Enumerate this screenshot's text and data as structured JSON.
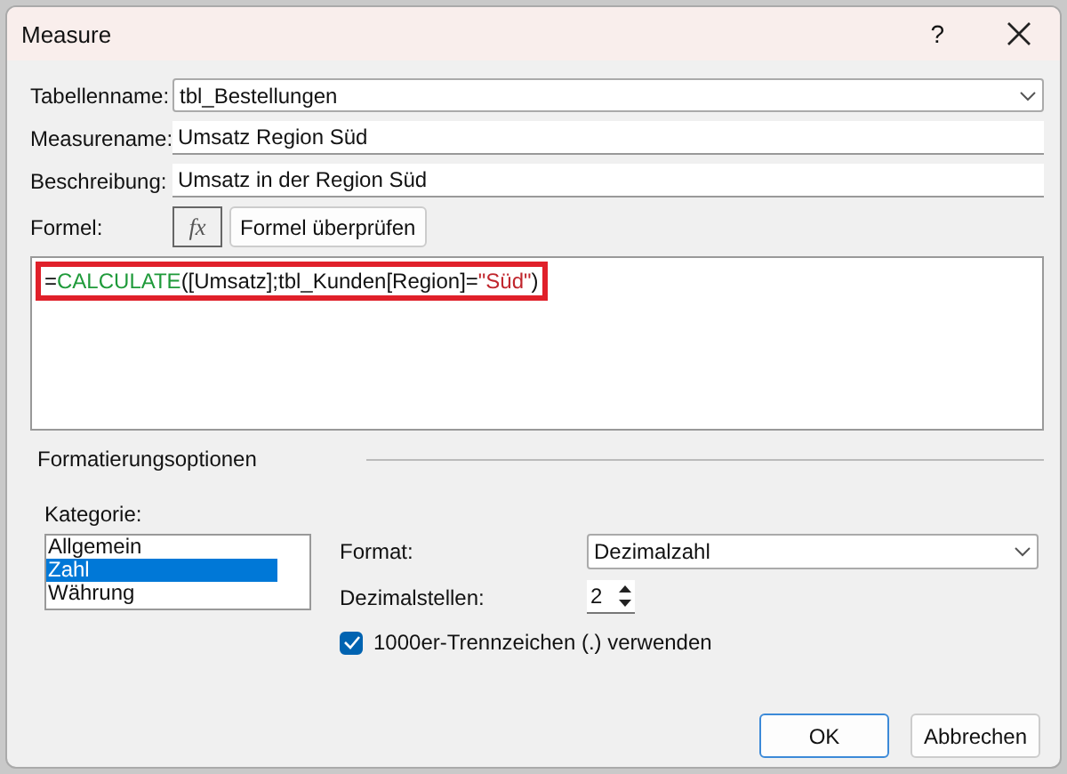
{
  "window": {
    "title": "Measure",
    "help": "?"
  },
  "table_name": {
    "label": "Tabellenname:",
    "value": "tbl_Bestellungen"
  },
  "measure_name": {
    "label": "Measurename:",
    "value": "Umsatz Region Süd"
  },
  "description": {
    "label": "Beschreibung:",
    "value": "Umsatz in der Region Süd"
  },
  "formula": {
    "label": "Formel:",
    "fx": "fx",
    "check_button": "Formel überprüfen",
    "highlighted": true,
    "segments": [
      {
        "kind": "plain",
        "text": "="
      },
      {
        "kind": "function",
        "text": "CALCULATE"
      },
      {
        "kind": "plain",
        "text": "([Umsatz];tbl_Kunden[Region]="
      },
      {
        "kind": "string",
        "text": "\"Süd\""
      },
      {
        "kind": "plain",
        "text": ")"
      }
    ]
  },
  "format_options": {
    "title": "Formatierungsoptionen",
    "category_label": "Kategorie:",
    "categories": [
      {
        "label": "Allgemein",
        "selected": false
      },
      {
        "label": "Zahl",
        "selected": true
      },
      {
        "label": "Währung",
        "selected": false
      }
    ],
    "format_label": "Format:",
    "format_value": "Dezimalzahl",
    "decimals_label": "Dezimalstellen:",
    "decimals_value": "2",
    "separator": {
      "label": "1000er-Trennzeichen (.) verwenden",
      "checked": true
    }
  },
  "buttons": [
    {
      "label": "OK",
      "default": true
    },
    {
      "label": "Abbrechen",
      "default": false
    }
  ]
}
